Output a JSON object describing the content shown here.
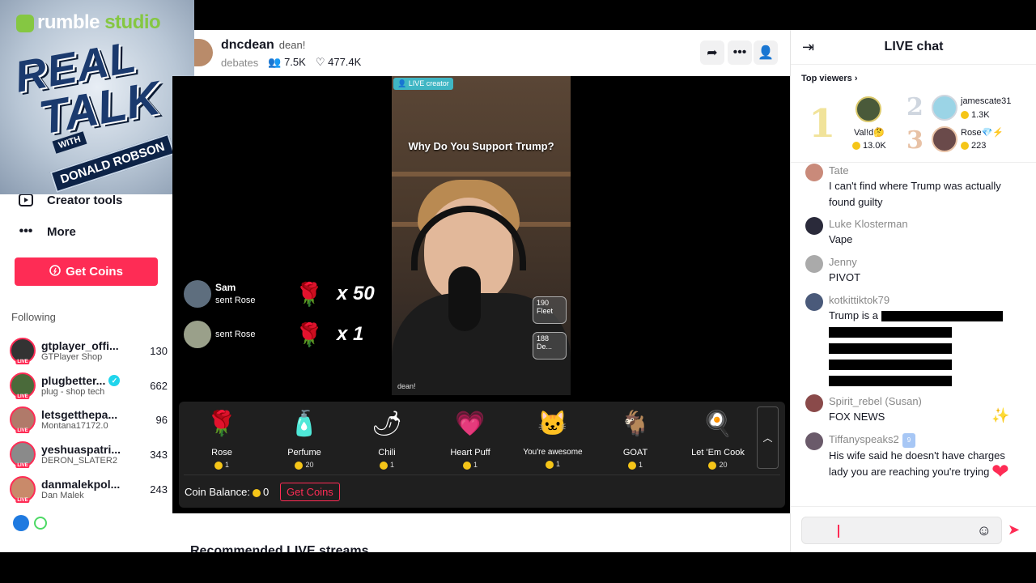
{
  "logo": {
    "brand_a": "rumble",
    "brand_b": "studio",
    "line1": "REAL",
    "line2": "TALK",
    "with": "WITH",
    "name": "DONALD ROBSON"
  },
  "sidebar": {
    "nav": [
      {
        "label": "Creator tools",
        "icon": "play-square-icon"
      },
      {
        "label": "More",
        "icon": "more-dots-icon"
      }
    ],
    "get_coins": "Get Coins",
    "following_title": "Following",
    "following": [
      {
        "name": "gtplayer_offi...",
        "sub": "GTPlayer Shop",
        "count": "130",
        "verified": false
      },
      {
        "name": "plugbetter...",
        "sub": "plug - shop tech",
        "count": "662",
        "verified": true
      },
      {
        "name": "letsgetthepa...",
        "sub": "Montana17172.0",
        "count": "96",
        "verified": false
      },
      {
        "name": "yeshuaspatri...",
        "sub": "DERON_SLATER2",
        "count": "343",
        "verified": false
      },
      {
        "name": "danmalekpol...",
        "sub": "Dan Malek",
        "count": "243",
        "verified": false
      }
    ],
    "live_badge": "LIVE"
  },
  "stream": {
    "host": "dncdean",
    "nickname": "dean!",
    "category": "debates",
    "viewers": "7.5K",
    "likes": "477.4K",
    "live_creator_tag": "LIVE creator",
    "question": "Why Do You Support Trump?",
    "watermark": "dean!",
    "badges": [
      {
        "n": "190",
        "l": "Fleet"
      },
      {
        "n": "188",
        "l": "De..."
      }
    ]
  },
  "gift_feed": [
    {
      "user": "Sam",
      "action": "sent Rose",
      "mult": "x 50"
    },
    {
      "user": "",
      "action": "sent Rose",
      "mult": "x 1"
    }
  ],
  "gifts": [
    {
      "label": "Rose",
      "price": "1",
      "icon": "🌹"
    },
    {
      "label": "Perfume",
      "price": "20",
      "icon": "🧴"
    },
    {
      "label": "Chili",
      "price": "1",
      "icon": "🌶"
    },
    {
      "label": "Heart Puff",
      "price": "1",
      "icon": "💗"
    },
    {
      "label": "You're awesome",
      "price": "1",
      "icon": "🐱"
    },
    {
      "label": "GOAT",
      "price": "1",
      "icon": "🐐"
    },
    {
      "label": "Let 'Em Cook",
      "price": "20",
      "icon": "🍳"
    }
  ],
  "coin_balance_label": "Coin Balance:",
  "coin_balance": "0",
  "gb_get_coins": "Get Coins",
  "recommended": "Recommended LIVE streams",
  "chat": {
    "title": "LIVE chat",
    "top_viewers_label": "Top viewers",
    "top_viewers": [
      {
        "rank": "1",
        "name": "Val!d🤔",
        "score": "13.0K"
      },
      {
        "rank": "2",
        "name": "jamescate31",
        "score": "1.3K"
      },
      {
        "rank": "3",
        "name": "Rose💎⚡",
        "score": "223"
      }
    ],
    "messages": [
      {
        "user": "Tate",
        "text": "I can't find where Trump was actually found guilty"
      },
      {
        "user": "Luke Klosterman",
        "text": "Vape"
      },
      {
        "user": "Jenny",
        "text": "PIVOT"
      },
      {
        "user": "kotkittiktok79",
        "text": "Trump is a"
      },
      {
        "user": "Spirit_rebel (Susan)",
        "text": "FOX NEWS"
      },
      {
        "user": "Tiffanyspeaks2",
        "level": "9",
        "text": "His wife said he doesn't have charges lady you are reaching you're trying"
      }
    ]
  },
  "colors": {
    "accent": "#fe2c55",
    "coin": "#f5c518",
    "live_creator": "#3fb6c4"
  }
}
